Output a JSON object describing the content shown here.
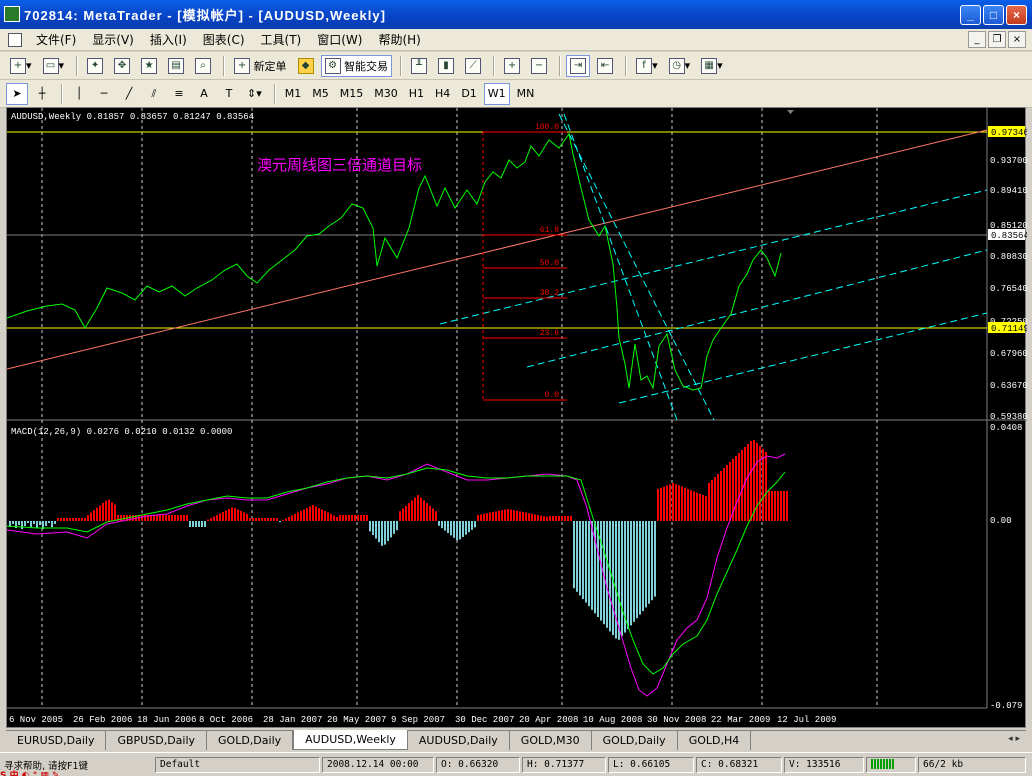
{
  "window": {
    "title": "702814: MetaTrader - [模拟帐户] - [AUDUSD,Weekly]"
  },
  "menu": [
    "文件(F)",
    "显示(V)",
    "插入(I)",
    "图表(C)",
    "工具(T)",
    "窗口(W)",
    "帮助(H)"
  ],
  "toolbar1": {
    "new_order": "新定单",
    "expert": "智能交易"
  },
  "toolbar2": {
    "timeframes": [
      "M1",
      "M5",
      "M15",
      "M30",
      "H1",
      "H4",
      "D1",
      "W1",
      "MN"
    ],
    "active": "W1"
  },
  "chart": {
    "header": "AUDUSD,Weekly  0.81857 0.83657 0.81247 0.83564",
    "annotation": "澳元周线图三倍通道目标",
    "fib_levels": [
      "100.0",
      "61.8",
      "50.0",
      "38.2",
      "23.6",
      "0.0"
    ],
    "price_labels": [
      "0.93700",
      "0.89410",
      "0.85120",
      "0.80830",
      "0.76540",
      "0.72250",
      "0.67960",
      "0.63670",
      "0.59380"
    ],
    "hl_labels": {
      "top": "0.97346",
      "mid": "0.83564",
      "low": "0.71149"
    },
    "indicator_header": "MACD(12,26,9) 0.0276 0.0210 0.0132 0.0000",
    "macd_labels": [
      "0.0408",
      "0.00",
      "-0.079"
    ],
    "date_labels": [
      "6 Nov 2005",
      "26 Feb 2006",
      "18 Jun 2006",
      "8 Oct 2006",
      "28 Jan 2007",
      "20 May 2007",
      "9 Sep 2007",
      "30 Dec 2007",
      "20 Apr 2008",
      "10 Aug 2008",
      "30 Nov 2008",
      "22 Mar 2009",
      "12 Jul 2009"
    ],
    "colors": {
      "price": "#00ff00",
      "hline": "#ffff00",
      "fib": "#ff0000",
      "channel": "#00ffff",
      "trend": "#ff7a6a",
      "hist_up": "#ff0000",
      "hist_down": "#7fd0d8",
      "signal": "#ff00ff",
      "macd_line": "#00ff00",
      "text": "#ffffff",
      "annotation": "#ff00ff"
    }
  },
  "tabs": [
    "EURUSD,Daily",
    "GBPUSD,Daily",
    "GOLD,Daily",
    "AUDUSD,Weekly",
    "AUDUSD,Daily",
    "GOLD,M30",
    "GOLD,Daily",
    "GOLD,H4"
  ],
  "active_tab": "AUDUSD,Weekly",
  "status": {
    "help": "寻求帮助, 请按F1键",
    "profile": "Default",
    "time": "2008.12.14 00:00",
    "open": "O: 0.66320",
    "high": "H: 0.71377",
    "low": "L: 0.66105",
    "close": "C: 0.68321",
    "volume": "V: 133516",
    "traffic": "66/2 kb"
  }
}
